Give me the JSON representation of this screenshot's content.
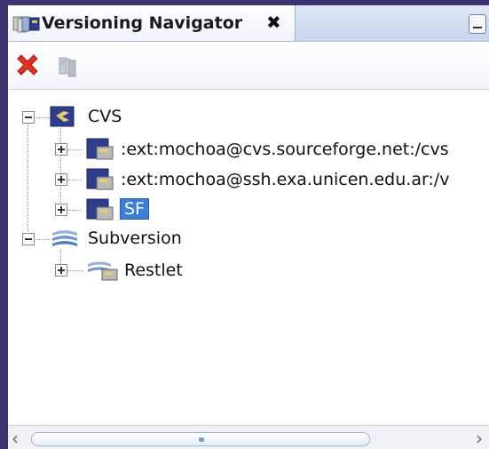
{
  "tab": {
    "title": "Versioning Navigator",
    "close_icon": "close-icon"
  },
  "toolbar": {
    "delete_icon": "red-x-icon",
    "refresh_icon": "refresh-icon"
  },
  "tree": {
    "cvs": {
      "label": "CVS",
      "expanded": true,
      "children": [
        {
          "label": ":ext:mochoa@cvs.sourceforge.net:/cvs",
          "expanded": false
        },
        {
          "label": ":ext:mochoa@ssh.exa.unicen.edu.ar:/v",
          "expanded": false
        },
        {
          "label": "SF",
          "expanded": false,
          "selected": true
        }
      ]
    },
    "subversion": {
      "label": "Subversion",
      "expanded": true,
      "children": [
        {
          "label": "Restlet",
          "expanded": false
        }
      ]
    }
  },
  "colors": {
    "frame": "#3a3570",
    "selection": "#3d7fd6",
    "tab_bg": "#dfe9f7"
  }
}
